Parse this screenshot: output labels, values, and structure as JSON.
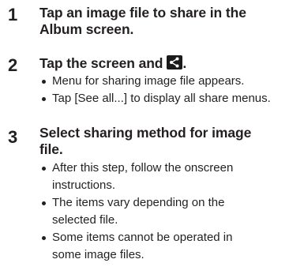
{
  "steps": [
    {
      "number": "1",
      "title_line1": "Tap an image file to share in the",
      "title_line2": "Album screen."
    },
    {
      "number": "2",
      "title_text": "Tap the screen and",
      "title_suffix": ".",
      "icon": "share-icon",
      "bullets": [
        "Menu for sharing image file appears.",
        "Tap [See all...] to display all share menus."
      ]
    },
    {
      "number": "3",
      "title_line1": "Select sharing method for image",
      "title_line2": "file.",
      "bullets": [
        {
          "line1": "After this step, follow the onscreen",
          "line2": "instructions."
        },
        {
          "line1": "The items vary depending on the",
          "line2": "selected file."
        },
        {
          "line1": "Some items cannot be operated in",
          "line2": "some image files."
        }
      ]
    }
  ]
}
